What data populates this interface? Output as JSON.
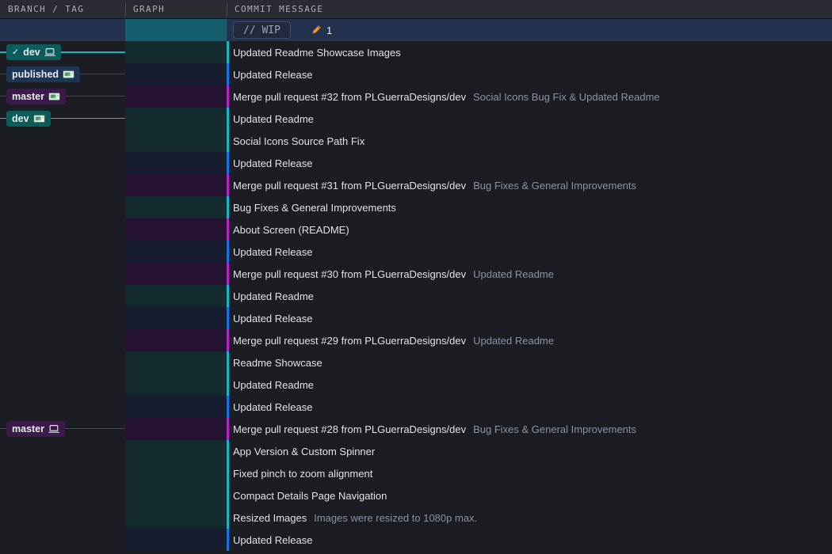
{
  "columns": {
    "branch_tag": "BRANCH / TAG",
    "graph": "GRAPH",
    "commit_message": "COMMIT MESSAGE"
  },
  "colors": {
    "lane_cyan": "#19b5c4",
    "lane_blue": "#1675e0",
    "lane_magenta": "#b026c9",
    "stash_dotted": "#cc2ecc",
    "wip_cell": "#155e6e",
    "selected_row": "#243css",
    "header_bg": "#2a2c33",
    "page_bg": "#1b1d23",
    "badge_teal": "#0d5c5c",
    "badge_navy": "#1e3556",
    "badge_purple": "#3b1b49"
  },
  "wip_row": {
    "label": "// WIP",
    "change_count": "1",
    "pencil_icon": "pencil-icon",
    "node": "dashed-circle-node"
  },
  "branch_labels": [
    {
      "row": 1,
      "text": "dev",
      "checked": true,
      "style": "teal",
      "icon": "local-laptop-icon"
    },
    {
      "row": 2,
      "text": "published",
      "checked": false,
      "style": "navy",
      "icon": "remote-server-icon"
    },
    {
      "row": 3,
      "text": "master",
      "checked": false,
      "style": "purple",
      "icon": "remote-server-icon"
    },
    {
      "row": 4,
      "text": "dev",
      "checked": false,
      "style": "teal",
      "icon": "remote-server-icon"
    },
    {
      "row": 18,
      "text": "master",
      "checked": false,
      "style": "purple",
      "icon": "local-laptop-icon"
    }
  ],
  "commits": [
    {
      "subject": "Updated Readme Showcase Images",
      "detail": "",
      "lane": "cyan",
      "avatar": "red"
    },
    {
      "subject": "Updated Release",
      "detail": "",
      "lane": "blue",
      "avatar": "blue"
    },
    {
      "subject": "Merge pull request #32 from PLGuerraDesigns/dev",
      "detail": "Social Icons Bug Fix & Updated Readme",
      "lane": "magenta",
      "avatar": "none"
    },
    {
      "subject": "Updated Readme",
      "detail": "",
      "lane": "cyan",
      "avatar": "red"
    },
    {
      "subject": "Social Icons Source Path Fix",
      "detail": "",
      "lane": "cyan",
      "avatar": "red"
    },
    {
      "subject": "Updated Release",
      "detail": "",
      "lane": "blue",
      "avatar": "blue"
    },
    {
      "subject": "Merge pull request #31 from PLGuerraDesigns/dev",
      "detail": "Bug Fixes & General Improvements",
      "lane": "magenta",
      "avatar": "none"
    },
    {
      "subject": "Bug Fixes & General Improvements",
      "detail": "",
      "lane": "cyan",
      "avatar": "red"
    },
    {
      "subject": "About Screen (README)",
      "detail": "",
      "lane": "magenta",
      "avatar": "stash"
    },
    {
      "subject": "Updated Release",
      "detail": "",
      "lane": "blue",
      "avatar": "blue"
    },
    {
      "subject": "Merge pull request #30 from PLGuerraDesigns/dev",
      "detail": "Updated Readme",
      "lane": "magenta",
      "avatar": "none"
    },
    {
      "subject": "Updated Readme",
      "detail": "",
      "lane": "cyan",
      "avatar": "red"
    },
    {
      "subject": "Updated Release",
      "detail": "",
      "lane": "blue",
      "avatar": "blue"
    },
    {
      "subject": "Merge pull request #29 from PLGuerraDesigns/dev",
      "detail": "Updated Readme",
      "lane": "magenta",
      "avatar": "none"
    },
    {
      "subject": "Readme Showcase",
      "detail": "",
      "lane": "cyan",
      "avatar": "red"
    },
    {
      "subject": "Updated Readme",
      "detail": "",
      "lane": "cyan",
      "avatar": "red"
    },
    {
      "subject": "Updated Release",
      "detail": "",
      "lane": "blue",
      "avatar": "blue"
    },
    {
      "subject": "Merge pull request #28 from PLGuerraDesigns/dev",
      "detail": "Bug Fixes & General Improvements",
      "lane": "magenta",
      "avatar": "none"
    },
    {
      "subject": "App Version & Custom Spinner",
      "detail": "",
      "lane": "cyan",
      "avatar": "red"
    },
    {
      "subject": "Fixed pinch to zoom alignment",
      "detail": "",
      "lane": "cyan",
      "avatar": "red"
    },
    {
      "subject": "Compact Details Page Navigation",
      "detail": "",
      "lane": "cyan",
      "avatar": "red"
    },
    {
      "subject": "Resized Images",
      "detail": "Images were resized to 1080p max.",
      "lane": "cyan",
      "avatar": "red"
    },
    {
      "subject": "Updated Release",
      "detail": "",
      "lane": "blue",
      "avatar": "blue"
    }
  ]
}
